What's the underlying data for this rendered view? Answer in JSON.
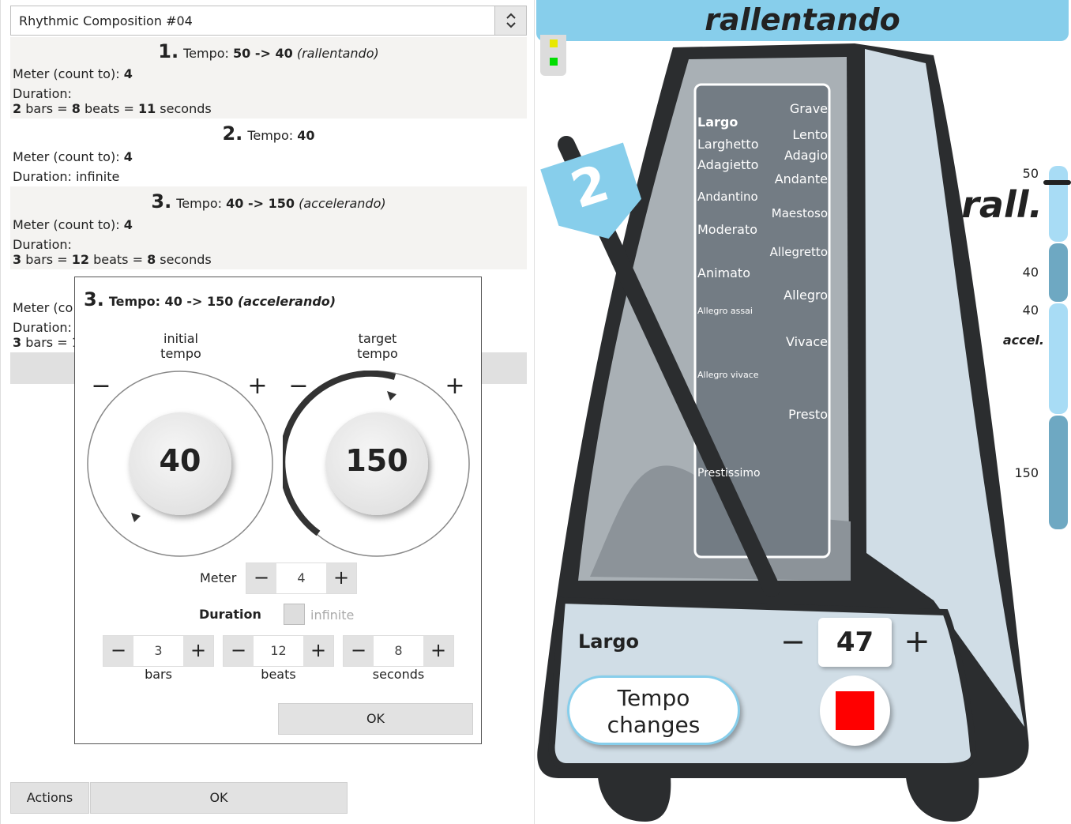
{
  "composition": {
    "selected": "Rhythmic Composition #04"
  },
  "entries": [
    {
      "num": "1.",
      "tempo_label": "Tempo:",
      "tempo": "50 -> 40",
      "modifier": "(rallentando)",
      "meter_label": "Meter (count to):",
      "meter": "4",
      "duration_label": "Duration:",
      "bars": "2",
      "bars_word": "bars =",
      "beats": "8",
      "beats_word": "beats =",
      "seconds": "11",
      "seconds_word": "seconds"
    },
    {
      "num": "2.",
      "tempo_label": "Tempo:",
      "tempo": "40",
      "meter_label": "Meter (count to):",
      "meter": "4",
      "duration_label": "Duration: infinite"
    },
    {
      "num": "3.",
      "tempo_label": "Tempo:",
      "tempo": "40 -> 150",
      "modifier": "(accelerando)",
      "meter_label": "Meter (count to):",
      "meter": "4",
      "duration_label": "Duration:",
      "bars": "3",
      "bars_word": "bars =",
      "beats": "12",
      "beats_word": "beats =",
      "seconds": "8",
      "seconds_word": "seconds"
    },
    {
      "meter_label": "Meter (co",
      "duration_label": "Duration:",
      "bars": "3",
      "bars_word": "bars = 1"
    }
  ],
  "dialog": {
    "num": "3.",
    "title": "Tempo: 40 -> 150",
    "modifier": "(accelerando)",
    "initial_label_1": "initial",
    "initial_label_2": "tempo",
    "target_label_1": "target",
    "target_label_2": "tempo",
    "initial_value": "40",
    "target_value": "150",
    "minus": "−",
    "plus": "+",
    "meter_label": "Meter",
    "meter_value": "4",
    "duration_label": "Duration",
    "infinite_label": "infinite",
    "bars_value": "3",
    "beats_value": "12",
    "seconds_value": "8",
    "bars_label": "bars",
    "beats_label": "beats",
    "seconds_label": "seconds",
    "ok": "OK"
  },
  "bottom": {
    "actions": "Actions",
    "ok": "OK"
  },
  "metronome": {
    "banner": "rallentando",
    "beat_number": "2",
    "tempo_names_left": [
      "Largo",
      "Larghetto",
      "Adagietto",
      "Andantino",
      "Moderato",
      "Animato",
      "Allegro assai",
      "Allegro vivace",
      "Prestissimo"
    ],
    "tempo_names_right": [
      "Grave",
      "Lento",
      "Adagio",
      "Andante",
      "Maestoso",
      "Allegretto",
      "Allegro",
      "Vivace",
      "Presto"
    ],
    "current_name": "Largo",
    "bpm": "47",
    "minus": "−",
    "plus": "+",
    "tempo_changes_1": "Tempo",
    "tempo_changes_2": "changes",
    "indicator_colors": [
      "#e8e800",
      "#00dd00"
    ]
  },
  "timeline": {
    "rall": "rall.",
    "accel": "accel.",
    "labels": [
      "50",
      "40",
      "40",
      "150"
    ]
  },
  "colors": {
    "banner": "#87ceeb",
    "body_light": "#d0dde6",
    "outline": "#222222",
    "timeline_light": "#a8dcf5",
    "timeline_dark": "#6ea8c2",
    "stop": "#ff0000"
  }
}
